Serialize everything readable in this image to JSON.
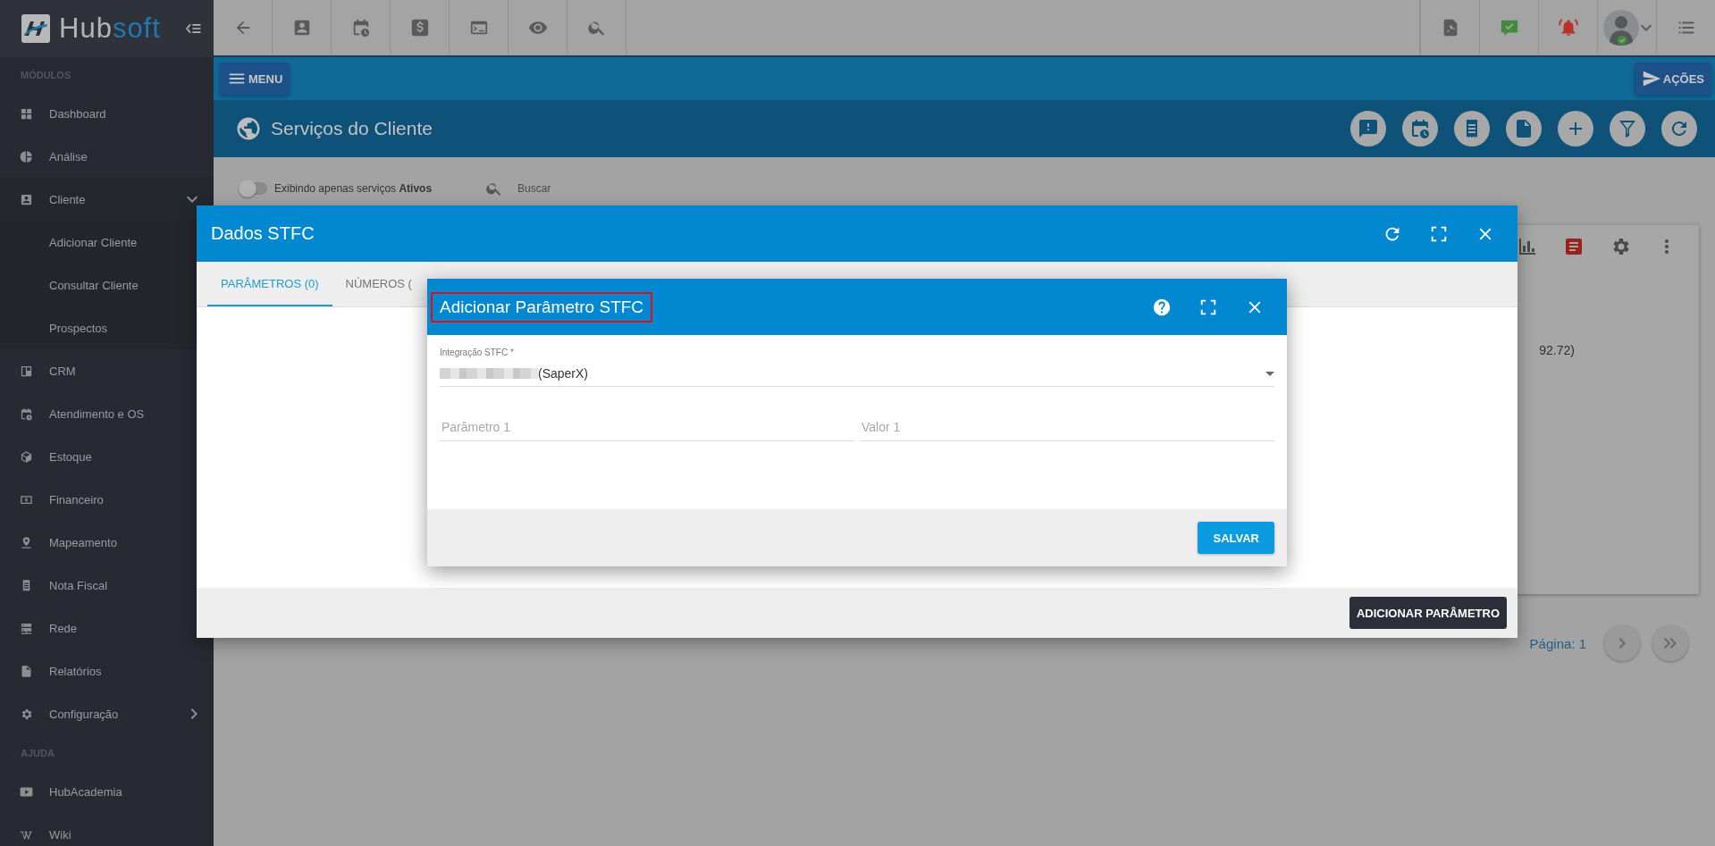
{
  "sidebar": {
    "brand_start": "Hub",
    "brand_end": "soft",
    "sections": [
      {
        "title": "MÓDULOS",
        "items": [
          {
            "label": "Dashboard"
          },
          {
            "label": "Análise"
          },
          {
            "label": "Cliente",
            "expanded": true,
            "children": [
              {
                "label": "Adicionar Cliente"
              },
              {
                "label": "Consultar Cliente"
              },
              {
                "label": "Prospectos"
              }
            ]
          },
          {
            "label": "CRM"
          },
          {
            "label": "Atendimento e OS"
          },
          {
            "label": "Estoque"
          },
          {
            "label": "Financeiro"
          },
          {
            "label": "Mapeamento"
          },
          {
            "label": "Nota Fiscal"
          },
          {
            "label": "Rede"
          },
          {
            "label": "Relatórios"
          },
          {
            "label": "Configuração",
            "expanded": false
          }
        ]
      },
      {
        "title": "AJUDA",
        "items": [
          {
            "label": "HubAcademia"
          },
          {
            "label": "Wiki"
          }
        ]
      }
    ]
  },
  "menu_button": "MENU",
  "actions_button": "AÇÕES",
  "page_title": "Serviços do Cliente",
  "filter": {
    "text": "Exibindo apenas serviços **Ativos**",
    "on": false
  },
  "search": {
    "placeholder": "Buscar"
  },
  "card": {
    "partial_text": "92.72)"
  },
  "pagination": {
    "page": "Página: 1"
  },
  "dialog": {
    "title": "Dados STFC",
    "tabs": [
      {
        "label": "PARÂMETROS (0)",
        "selected": true
      },
      {
        "label": "NÚMEROS (",
        "selected": false
      }
    ],
    "add_button": "ADICIONAR PARÂMETRO"
  },
  "subdialog": {
    "title": "Adicionar Parâmetro STFC",
    "highlighted": true,
    "integration": {
      "label": "Integração STFC *",
      "value": "(SaperX)"
    },
    "fields": [
      {
        "placeholder": "Parâmetro 1"
      },
      {
        "placeholder": "Valor 1"
      }
    ],
    "save_button": "SALVAR"
  }
}
